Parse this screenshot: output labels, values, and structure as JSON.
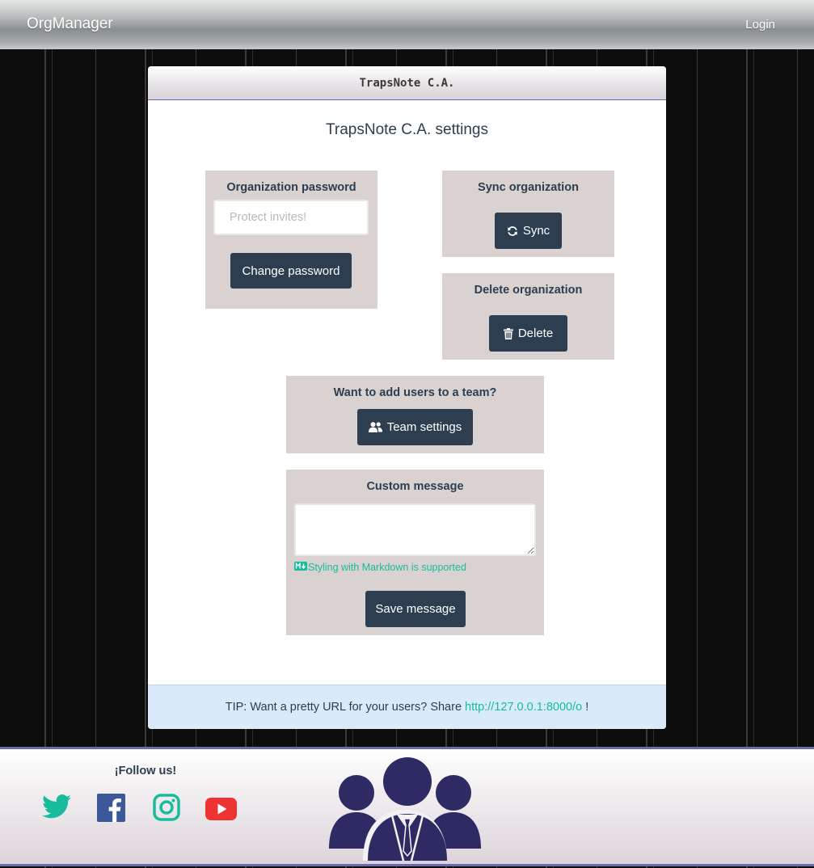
{
  "navbar": {
    "brand": "OrgManager",
    "login_label": "Login"
  },
  "card": {
    "header_title": "TrapsNote C.A.",
    "page_title": "TrapsNote C.A. settings"
  },
  "password_box": {
    "title": "Organization password",
    "input_placeholder": "Protect invites!",
    "input_value": "",
    "button_label": "Change password"
  },
  "sync_box": {
    "title": "Sync organization",
    "button_label": "Sync",
    "icon": "refresh-icon"
  },
  "delete_box": {
    "title": "Delete organization",
    "button_label": "Delete",
    "icon": "trash-icon"
  },
  "team_box": {
    "title": "Want to add users to a team?",
    "button_label": "Team settings",
    "icon": "users-icon"
  },
  "message_box": {
    "title": "Custom message",
    "textarea_value": "",
    "markdown_note": "Styling with Markdown is supported",
    "button_label": "Save message"
  },
  "tip": {
    "prefix": "TIP: Want a pretty URL for your users? Share ",
    "link": "http://127.0.0.1:8000/o",
    "suffix": " !"
  },
  "footer": {
    "follow_label": "¡Follow us!",
    "socials": [
      "twitter-icon",
      "facebook-icon",
      "instagram-icon",
      "youtube-icon"
    ]
  },
  "colors": {
    "primary": "#2c3e50",
    "accent": "#18bc9c",
    "box_bg": "#d9d2d1",
    "tip_bg": "#d9ebfa",
    "logo": "#2e2a63"
  }
}
